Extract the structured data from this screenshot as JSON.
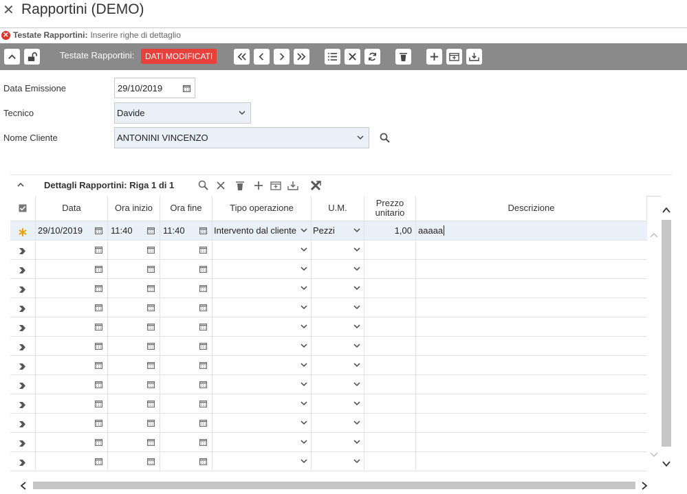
{
  "window": {
    "title": "Rapportini (DEMO)"
  },
  "message": {
    "title": "Testate Rapportini:",
    "text": "Inserire righe di dettaglio"
  },
  "toolbar": {
    "label": "Testate Rapportini:",
    "badge": "DATI MODIFICATI",
    "badge_color": "#e8403a"
  },
  "form": {
    "data_emissione": {
      "label": "Data Emissione",
      "value": "29/10/2019"
    },
    "tecnico": {
      "label": "Tecnico",
      "value": "Davide"
    },
    "nome_cliente": {
      "label": "Nome Cliente",
      "value": "ANTONINI VINCENZO"
    }
  },
  "grid": {
    "title": "Dettagli Rapportini: Riga 1 di 1",
    "columns": [
      "Data",
      "Ora inizio",
      "Ora fine",
      "Tipo operazione",
      "U.M.",
      "Prezzo unitario",
      "Descrizione"
    ],
    "row1": {
      "data": "29/10/2019",
      "ora_inizio": "11:40",
      "ora_fine": "11:40",
      "tipo_operazione": "Intervento dal cliente",
      "um": "Pezzi",
      "prezzo": "1,00",
      "descrizione": "aaaaa"
    },
    "empty_rows": 12
  },
  "colors": {
    "toolbar": "#8a8a8a",
    "active_row": "#eaf0f7",
    "new_row_star": "#f0a000"
  }
}
